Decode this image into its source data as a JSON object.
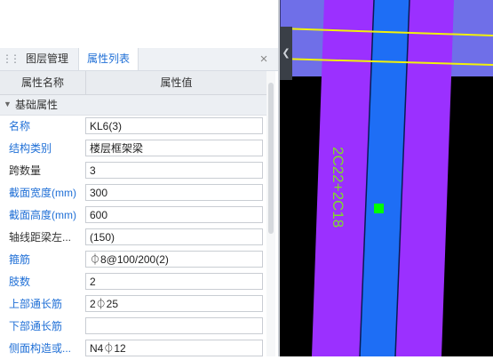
{
  "panel": {
    "tabs": [
      {
        "label": "图层管理"
      },
      {
        "label": "属性列表"
      }
    ],
    "close_label": "×",
    "header": {
      "col_name": "属性名称",
      "col_value": "属性值"
    },
    "group": {
      "label": "基础属性"
    },
    "rows": [
      {
        "name": "名称",
        "value": "KL6(3)",
        "name_color": "blue"
      },
      {
        "name": "结构类别",
        "value": "楼层框架梁",
        "name_color": "blue"
      },
      {
        "name": "跨数量",
        "value": "3",
        "name_color": "black"
      },
      {
        "name": "截面宽度(mm)",
        "value": "300",
        "name_color": "blue"
      },
      {
        "name": "截面高度(mm)",
        "value": "600",
        "name_color": "blue"
      },
      {
        "name": "轴线距梁左...",
        "value": "(150)",
        "name_color": "black"
      },
      {
        "name": "箍筋",
        "value": "⏀8@100/200(2)",
        "name_color": "blue"
      },
      {
        "name": "肢数",
        "value": "2",
        "name_color": "blue"
      },
      {
        "name": "上部通长筋",
        "value": "2⏀25",
        "name_color": "blue"
      },
      {
        "name": "下部通长筋",
        "value": "",
        "name_color": "blue"
      },
      {
        "name": "侧面构造或...",
        "value": "N4⏀12",
        "name_color": "blue"
      }
    ]
  },
  "canvas": {
    "rebar_label": "2C22+2C18",
    "colors": {
      "background": "#000000",
      "beam_purple": "#9b30ff",
      "beam_blue": "#1e6ef5",
      "band_blue": "#6f6fe8",
      "line_yellow": "#f2f20a",
      "text_green": "#7ddc2a",
      "marker_green": "#00ff00"
    },
    "collapse_icon": "chevron-left-icon"
  }
}
